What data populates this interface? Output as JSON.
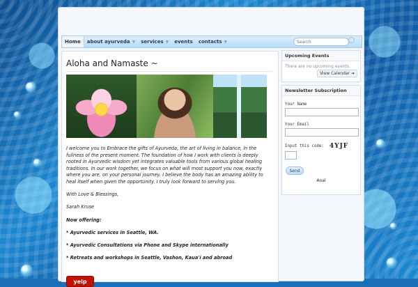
{
  "nav": {
    "items": [
      {
        "label": "Home",
        "active": true
      },
      {
        "label": "about ayurveda",
        "has_submenu": true
      },
      {
        "label": "services",
        "has_submenu": true
      },
      {
        "label": "events"
      },
      {
        "label": "contacts",
        "has_submenu": true
      }
    ],
    "search_placeholder": "Search"
  },
  "main": {
    "title": "Aloha and Namaste ~",
    "paragraphs": [
      "I welcome you to Embrace the gifts of Ayurveda, the art of living in balance, in the fullness of the present moment.  The foundation of how I work with clients is deeply rooted in Ayurvedic wisdom yet integrates valuable tools from various global healing traditions.  In our work together, we focus on what will most support you now, exactly where you are, on your personal journey. I believe the body has an amazing ability to heal itself when given the opportunity. I truly look forward to serving you.",
      "With Love & Blessings,",
      "Sarah Kruse"
    ],
    "offering_title": "Now offering:",
    "offerings": [
      "* Ayurvedic services in Seattle, WA.",
      "* Ayurvedic Consultations via Phone and Skype internationally",
      "* Retreats and workshops in Seattle, Vashon, Kaua'i and abroad"
    ],
    "yelp_label": "yelp"
  },
  "upcoming_events": {
    "title": "Upcoming Events",
    "message": "There are no upcoming events.",
    "view_calendar": "View Calendar ➔"
  },
  "newsletter": {
    "title": "Newsletter Subscription",
    "name_label": "Your Name",
    "email_label": "Your Email",
    "code_label": "Input this code:",
    "captcha": "4YJF",
    "send_label": "Send",
    "footer": "Anal"
  },
  "colors": {
    "background": "#1a6fb8",
    "nav": "#b9dcf6",
    "panel": "#ffffff"
  }
}
